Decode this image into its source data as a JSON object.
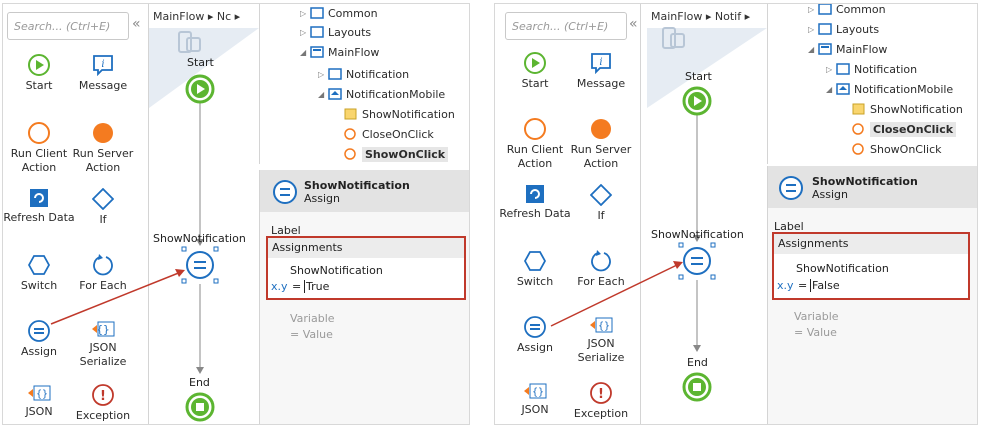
{
  "search": {
    "placeholder": "Search... (Ctrl+E)"
  },
  "toolbox": {
    "start": "Start",
    "message": "Message",
    "run_client_action": "Run Client Action",
    "run_server_action": "Run Server Action",
    "refresh_data": "Refresh Data",
    "if": "If",
    "switch": "Switch",
    "for_each": "For Each",
    "assign": "Assign",
    "json_serialize": "JSON Serialize",
    "json": "JSON",
    "exception": "Exception"
  },
  "left": {
    "flow_path": "MainFlow ▸ Nc ▸",
    "nodes": {
      "start": "Start",
      "assign": "ShowNotification",
      "end": "End"
    },
    "tree": {
      "common": "Common",
      "layouts": "Layouts",
      "mainflow": "MainFlow",
      "notification": "Notification",
      "notification_mobile": "NotificationMobile",
      "show_notification": "ShowNotification",
      "close_on_click": "CloseOnClick",
      "show_on_click": "ShowOnClick"
    },
    "props": {
      "title": "ShowNotification",
      "subtitle": "Assign",
      "label": "Label",
      "assignments": "Assignments",
      "target": "ShowNotification",
      "xy": "x.y",
      "eq": "=",
      "value": "True",
      "var_placeholder": "Variable",
      "value_placeholder": "= Value"
    }
  },
  "right": {
    "flow_path": "MainFlow ▸ Notif ▸",
    "nodes": {
      "start": "Start",
      "assign": "ShowNotification",
      "end": "End"
    },
    "tree": {
      "common": "Common",
      "layouts": "Layouts",
      "mainflow": "MainFlow",
      "notification": "Notification",
      "notification_mobile": "NotificationMobile",
      "show_notification": "ShowNotification",
      "close_on_click": "CloseOnClick",
      "show_on_click": "ShowOnClick"
    },
    "props": {
      "title": "ShowNotification",
      "subtitle": "Assign",
      "label": "Label",
      "assignments": "Assignments",
      "target": "ShowNotification",
      "xy": "x.y",
      "eq": "=",
      "value": "False",
      "var_placeholder": "Variable",
      "value_placeholder": "= Value"
    }
  },
  "colors": {
    "green": "#5cb531",
    "orange": "#f47b20",
    "blue": "#1e6fc0",
    "highlight": "#c0392b"
  }
}
